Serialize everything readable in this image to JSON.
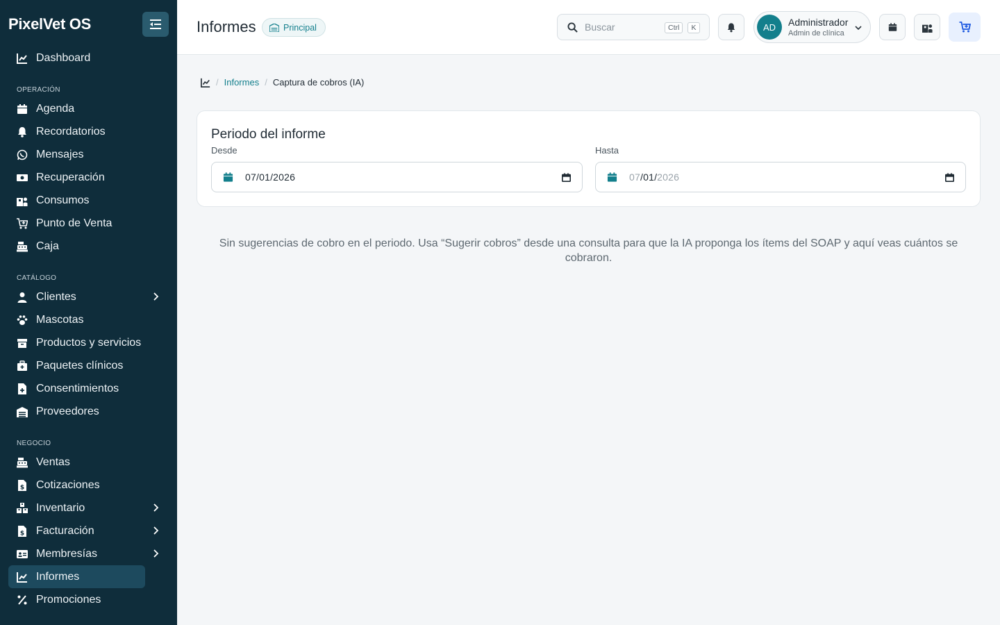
{
  "app": {
    "name": "PixelVet OS"
  },
  "sidebar": {
    "top": {
      "label": "Dashboard"
    },
    "sections": [
      {
        "label": "OPERACIÓN",
        "items": [
          {
            "label": "Agenda"
          },
          {
            "label": "Recordatorios"
          },
          {
            "label": "Mensajes"
          },
          {
            "label": "Recuperación"
          },
          {
            "label": "Consumos"
          },
          {
            "label": "Punto de Venta"
          },
          {
            "label": "Caja"
          }
        ]
      },
      {
        "label": "CATÁLOGO",
        "items": [
          {
            "label": "Clientes"
          },
          {
            "label": "Mascotas"
          },
          {
            "label": "Productos y servicios"
          },
          {
            "label": "Paquetes clínicos"
          },
          {
            "label": "Consentimientos"
          },
          {
            "label": "Proveedores"
          }
        ]
      },
      {
        "label": "NEGOCIO",
        "items": [
          {
            "label": "Ventas"
          },
          {
            "label": "Cotizaciones"
          },
          {
            "label": "Inventario"
          },
          {
            "label": "Facturación"
          },
          {
            "label": "Membresías"
          },
          {
            "label": "Informes"
          },
          {
            "label": "Promociones"
          }
        ]
      }
    ]
  },
  "header": {
    "title": "Informes",
    "branch": "Principal",
    "search": {
      "placeholder": "Buscar",
      "shortcut_ctrl": "Ctrl",
      "shortcut_key": "K"
    },
    "user": {
      "initials": "AD",
      "name": "Administrador",
      "role": "Admin de clínica"
    }
  },
  "breadcrumb": {
    "parent": "Informes",
    "current": "Captura de cobros (IA)"
  },
  "report": {
    "title": "Periodo del informe",
    "from": {
      "label": "Desde",
      "month": "07",
      "day": "01",
      "year": "2026"
    },
    "to": {
      "label": "Hasta",
      "month": "07",
      "day": "01",
      "year": "2026"
    }
  },
  "empty_state": "Sin sugerencias de cobro en el periodo. Usa “Sugerir cobros” desde una consulta para que la IA proponga los ítems del SOAP y aquí veas cuántos se cobraron.",
  "colors": {
    "sidebar_bg": "#0f2d3b",
    "accent": "#137f8c",
    "active_item": "#1d4a5e",
    "cart_accent": "#1a57e0"
  }
}
